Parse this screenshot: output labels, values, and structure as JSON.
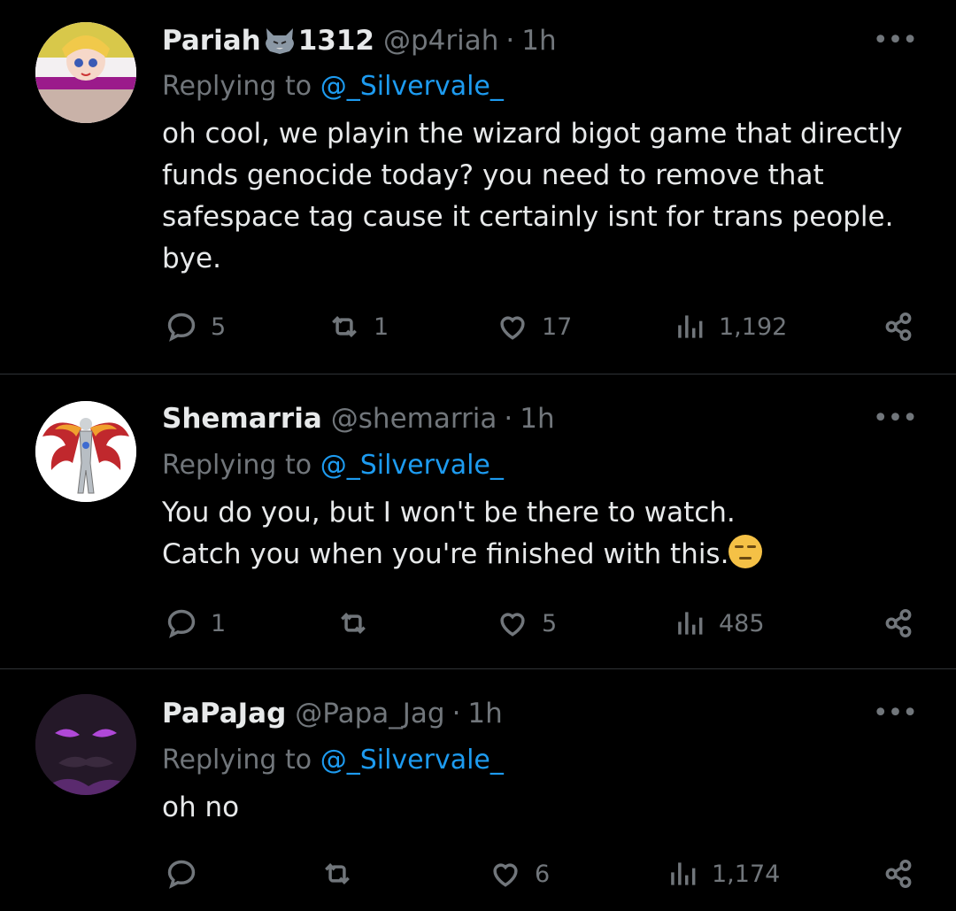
{
  "tweets": [
    {
      "name": "Pariah",
      "name_suffix": "1312",
      "name_emoji": "wolf-emoji",
      "handle": "@p4riah",
      "time": "1h",
      "replying_prefix": "Replying to",
      "replying_to": "@_Silvervale_",
      "text": "oh cool, we playin the wizard bigot game that directly\nfunds genocide today? you need to remove that\nsafespace tag cause it certainly isnt for trans people.\nbye.",
      "replies": "5",
      "retweets": "1",
      "likes": "17",
      "views": "1,192",
      "avatar": "anime-avatar"
    },
    {
      "name": "Shemarria",
      "handle": "@shemarria",
      "time": "1h",
      "replying_prefix": "Replying to",
      "replying_to": "@_Silvervale_",
      "text_line1": "You do you, but I won't be there to watch.",
      "text_line2": "Catch you when you're finished with this.",
      "text_emoji": "unamused-face-emoji",
      "replies": "1",
      "retweets": "",
      "likes": "5",
      "views": "485",
      "avatar": "winged-figure-avatar"
    },
    {
      "name": "PaPaJag",
      "handle": "@Papa_Jag",
      "time": "1h",
      "replying_prefix": "Replying to",
      "replying_to": "@_Silvervale_",
      "text": "oh no",
      "replies": "",
      "retweets": "",
      "likes": "6",
      "views": "1,174",
      "avatar": "masked-face-avatar"
    }
  ],
  "colors": {
    "background": "#000000",
    "text": "#e7e9ea",
    "muted": "#71767b",
    "link": "#1d9bf0",
    "divider": "#2f3336"
  },
  "icons": [
    "reply-icon",
    "retweet-icon",
    "like-icon",
    "views-icon",
    "share-icon",
    "more-icon"
  ]
}
